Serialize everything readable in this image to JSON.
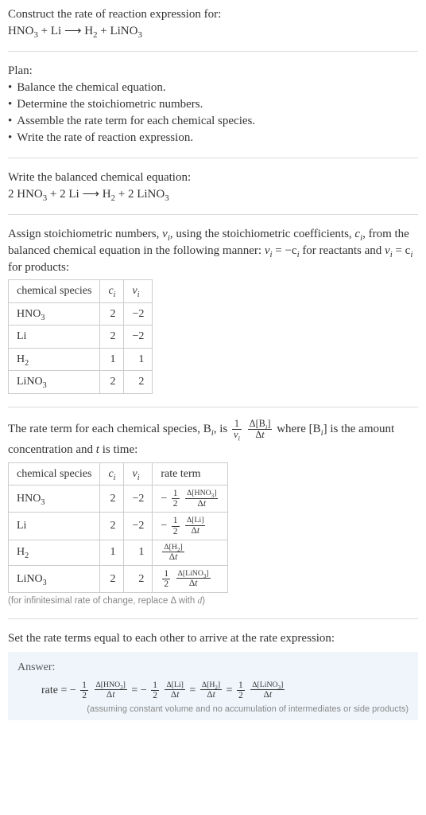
{
  "intro": {
    "line1": "Construct the rate of reaction expression for:",
    "eqn_lhs1": "HNO",
    "eqn_lhs1_sub": "3",
    "plus": " + ",
    "eqn_lhs2": "Li",
    "arrow": " ⟶ ",
    "eqn_rhs1": "H",
    "eqn_rhs1_sub": "2",
    "eqn_rhs2": "LiNO",
    "eqn_rhs2_sub": "3"
  },
  "plan": {
    "header": "Plan:",
    "b1": "Balance the chemical equation.",
    "b2": "Determine the stoichiometric numbers.",
    "b3": "Assemble the rate term for each chemical species.",
    "b4": "Write the rate of reaction expression."
  },
  "balanced": {
    "header": "Write the balanced chemical equation:",
    "c1": "2 HNO",
    "c1_sub": "3",
    "c2": "2 Li",
    "c3": "H",
    "c3_sub": "2",
    "c4": "2 LiNO",
    "c4_sub": "3"
  },
  "assign": {
    "text_a": "Assign stoichiometric numbers, ",
    "nu": "ν",
    "sub_i": "i",
    "text_b": ", using the stoichiometric coefficients, ",
    "c": "c",
    "text_c": ", from the balanced chemical equation in the following manner: ",
    "eq1_l": "ν",
    "eq1_r": " = −c",
    "text_d": " for reactants and ",
    "eq2_l": "ν",
    "eq2_r": " = c",
    "text_e": " for products:"
  },
  "t1": {
    "h_species": "chemical species",
    "h_c": "c",
    "h_c_sub": "i",
    "h_nu": "ν",
    "h_nu_sub": "i",
    "r1_s": "HNO",
    "r1_s_sub": "3",
    "r1_c": "2",
    "r1_nu": "−2",
    "r2_s": "Li",
    "r2_c": "2",
    "r2_nu": "−2",
    "r3_s": "H",
    "r3_s_sub": "2",
    "r3_c": "1",
    "r3_nu": "1",
    "r4_s": "LiNO",
    "r4_s_sub": "3",
    "r4_c": "2",
    "r4_nu": "2"
  },
  "ratetext": {
    "a": "The rate term for each chemical species, B",
    "a_sub": "i",
    "b": ", is ",
    "frac1_num": "1",
    "frac1_den_a": "ν",
    "frac1_den_sub": "i",
    "frac2_num_a": "Δ[B",
    "frac2_num_sub": "i",
    "frac2_num_b": "]",
    "frac2_den": "Δt",
    "c": " where [B",
    "c_sub": "i",
    "d": "] is the amount concentration and ",
    "t": "t",
    "e": " is time:"
  },
  "t2": {
    "h_species": "chemical species",
    "h_c": "c",
    "h_c_sub": "i",
    "h_nu": "ν",
    "h_nu_sub": "i",
    "h_rate": "rate term",
    "r1_s": "HNO",
    "r1_s_sub": "3",
    "r1_c": "2",
    "r1_nu": "−2",
    "r1_rt_pre": "−",
    "r1_rt_f1n": "1",
    "r1_rt_f1d": "2",
    "r1_rt_f2n": "Δ[HNO3]",
    "r1_rt_f2d": "Δt",
    "r2_s": "Li",
    "r2_c": "2",
    "r2_nu": "−2",
    "r2_rt_pre": "−",
    "r2_rt_f1n": "1",
    "r2_rt_f1d": "2",
    "r2_rt_f2n": "Δ[Li]",
    "r2_rt_f2d": "Δt",
    "r3_s": "H",
    "r3_s_sub": "2",
    "r3_c": "1",
    "r3_nu": "1",
    "r3_rt_f2n": "Δ[H2]",
    "r3_rt_f2d": "Δt",
    "r4_s": "LiNO",
    "r4_s_sub": "3",
    "r4_c": "2",
    "r4_nu": "2",
    "r4_rt_f1n": "1",
    "r4_rt_f1d": "2",
    "r4_rt_f2n": "Δ[LiNO3]",
    "r4_rt_f2d": "Δt"
  },
  "inf_note": "(for infinitesimal rate of change, replace Δ with d)",
  "finalline": "Set the rate terms equal to each other to arrive at the rate expression:",
  "answer": {
    "head": "Answer:",
    "rate": "rate = ",
    "neg": "−",
    "half_n": "1",
    "half_d": "2",
    "t1n": "Δ[HNO3]",
    "t1d": "Δt",
    "eq": " = ",
    "t2n": "Δ[Li]",
    "t2d": "Δt",
    "t3n": "Δ[H2]",
    "t3d": "Δt",
    "t4n": "Δ[LiNO3]",
    "t4d": "Δt",
    "note": "(assuming constant volume and no accumulation of intermediates or side products)"
  }
}
